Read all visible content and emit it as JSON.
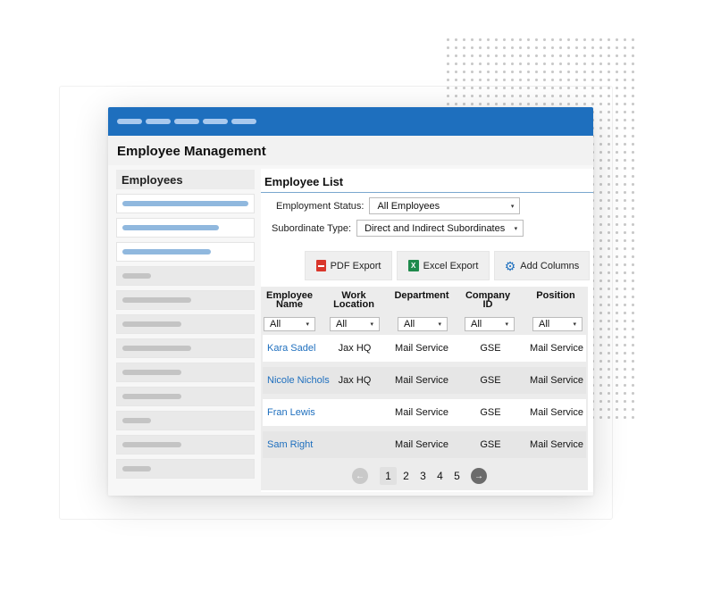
{
  "app": {
    "title": "Employee Management"
  },
  "sidebar": {
    "heading": "Employees"
  },
  "main": {
    "title": "Employee List",
    "filters": {
      "status_label": "Employment Status:",
      "status_value": "All Employees",
      "subordinate_label": "Subordinate Type:",
      "subordinate_value": "Direct and Indirect Subordinates"
    },
    "toolbar": {
      "pdf_label": "PDF Export",
      "excel_label": "Excel Export",
      "columns_label": "Add Columns"
    },
    "table": {
      "columns": [
        {
          "line1": "Employee",
          "line2": "Name"
        },
        {
          "line1": "Work",
          "line2": "Location"
        },
        {
          "line1": "Department",
          "line2": ""
        },
        {
          "line1": "Company",
          "line2": "ID"
        },
        {
          "line1": "Position",
          "line2": ""
        }
      ],
      "filter_value": "All",
      "rows": [
        {
          "name": "Kara Sadel",
          "location": "Jax HQ",
          "department": "Mail Service",
          "company_id": "GSE",
          "position": "Mail Service"
        },
        {
          "name": "Nicole Nichols",
          "location": "Jax HQ",
          "department": "Mail Service",
          "company_id": "GSE",
          "position": "Mail Service"
        },
        {
          "name": "Fran Lewis",
          "location": "",
          "department": "Mail Service",
          "company_id": "GSE",
          "position": "Mail Service"
        },
        {
          "name": "Sam Right",
          "location": "",
          "department": "Mail Service",
          "company_id": "GSE",
          "position": "Mail Service"
        }
      ]
    },
    "pagination": {
      "pages": [
        "1",
        "2",
        "3",
        "4",
        "5"
      ],
      "current": "1"
    }
  },
  "icons": {
    "caret": "▾",
    "gear": "⚙",
    "excel": "X",
    "prev": "←",
    "next": "→"
  },
  "colors": {
    "accent": "#1e6fbe",
    "link": "#1e6fbe",
    "pdf": "#d9362b",
    "excel": "#1f8a4c"
  }
}
